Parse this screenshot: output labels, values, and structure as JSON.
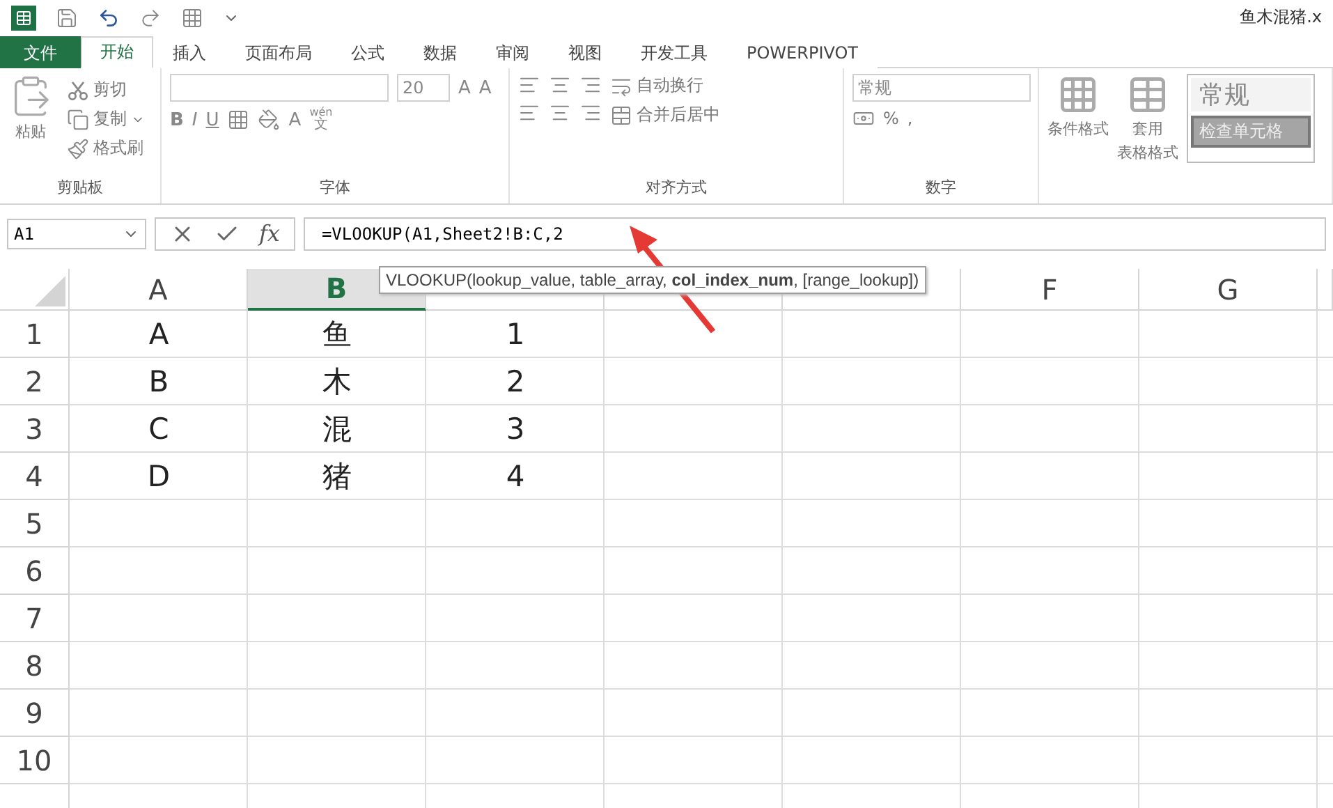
{
  "title_bar": {
    "file_name": "鱼木混猪.x"
  },
  "tabs": [
    {
      "label": "文件",
      "kind": "file",
      "selected": false
    },
    {
      "label": "开始",
      "kind": "tab",
      "selected": true
    },
    {
      "label": "插入",
      "kind": "tab",
      "selected": false
    },
    {
      "label": "页面布局",
      "kind": "tab",
      "selected": false
    },
    {
      "label": "公式",
      "kind": "tab",
      "selected": false
    },
    {
      "label": "数据",
      "kind": "tab",
      "selected": false
    },
    {
      "label": "审阅",
      "kind": "tab",
      "selected": false
    },
    {
      "label": "视图",
      "kind": "tab",
      "selected": false
    },
    {
      "label": "开发工具",
      "kind": "tab",
      "selected": false
    },
    {
      "label": "POWERPIVOT",
      "kind": "tab",
      "selected": false
    }
  ],
  "ribbon": {
    "clipboard": {
      "paste": "粘贴",
      "cut": "剪切",
      "copy": "复制",
      "format_painter": "格式刷",
      "label": "剪贴板"
    },
    "font": {
      "size": "20",
      "grow": "A",
      "shrink": "A",
      "bold": "B",
      "italic": "I",
      "underline": "U",
      "font_color": "A",
      "phonetic_ruby": "wén",
      "phonetic_base": "文",
      "label": "字体"
    },
    "alignment": {
      "wrap": "自动换行",
      "merge": "合并后居中",
      "label": "对齐方式"
    },
    "number": {
      "format": "常规",
      "percent": "%",
      "comma": ",",
      "label": "数字"
    },
    "styles": {
      "conditional": "条件格式",
      "table_format_1": "套用",
      "table_format_2": "表格格式",
      "gallery": [
        "常规",
        "检查单元格"
      ]
    }
  },
  "formula_bar": {
    "name_box": "A1",
    "function_button": "fx",
    "formula": "=VLOOKUP(A1,Sheet2!B:C,2"
  },
  "tooltip": "VLOOKUP(lookup_value, table_array, **col_index_num**, [range_lookup])",
  "sheet": {
    "columns": [
      {
        "label": "A",
        "selected": false
      },
      {
        "label": "B",
        "selected": true
      },
      {
        "selected": false
      },
      {
        "selected": false
      },
      {
        "selected": false
      },
      {
        "label": "F",
        "selected": false
      },
      {
        "label": "G",
        "selected": false
      }
    ],
    "rows": [
      {
        "label": "1",
        "cells": [
          "A",
          "鱼",
          "1"
        ]
      },
      {
        "label": "2",
        "cells": [
          "B",
          "木",
          "2"
        ]
      },
      {
        "label": "3",
        "cells": [
          "C",
          "混",
          "3"
        ]
      },
      {
        "label": "4",
        "cells": [
          "D",
          "猪",
          "4"
        ]
      },
      {
        "label": "5",
        "cells": []
      },
      {
        "label": "6",
        "cells": []
      },
      {
        "label": "7",
        "cells": []
      },
      {
        "label": "8",
        "cells": []
      },
      {
        "label": "9",
        "cells": []
      },
      {
        "label": "10",
        "cells": []
      }
    ]
  }
}
